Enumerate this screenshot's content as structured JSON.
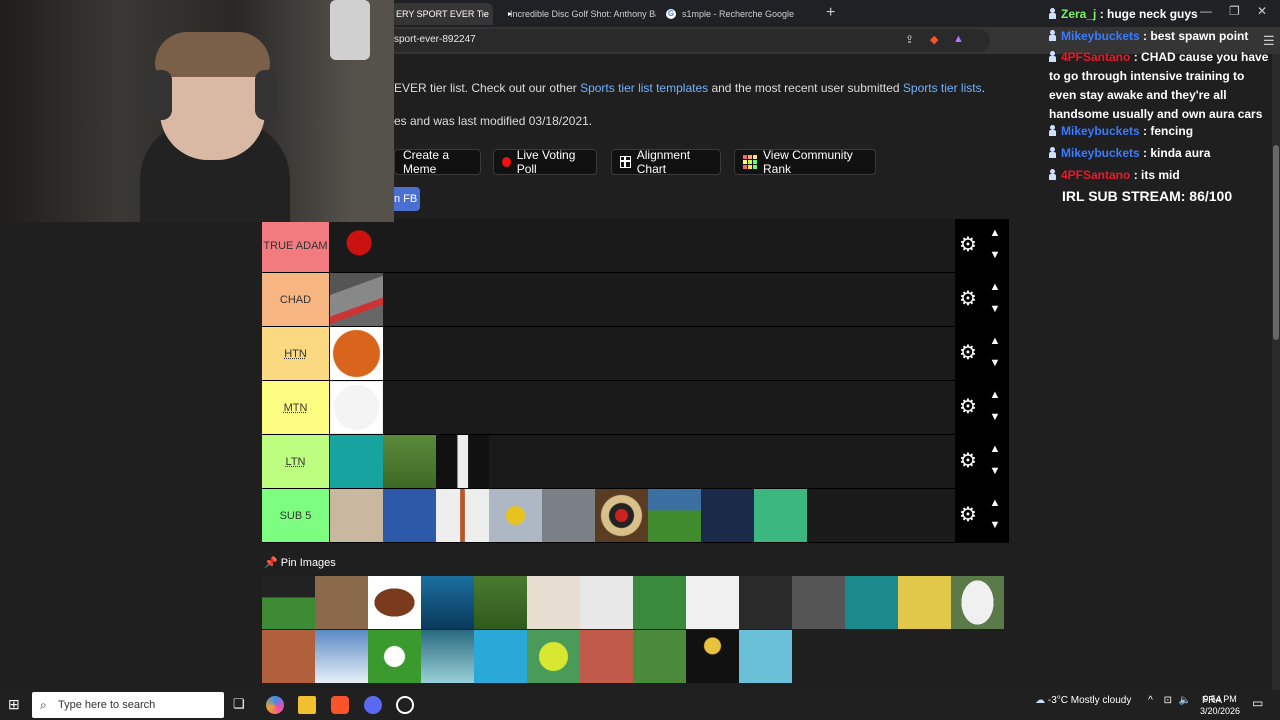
{
  "browser": {
    "tabs": [
      {
        "label": "ERY SPORT EVER Tie",
        "active": true
      },
      {
        "label": "Incredible Disc Golf Shot: Anthony Ba",
        "icon": "youtube-icon"
      },
      {
        "label": "s1mple - Recherche Google",
        "icon": "google-icon"
      }
    ],
    "new_tab": "+",
    "url": "sport-ever-892247"
  },
  "page": {
    "intro_prefix": "EVER tier list. Check out our other ",
    "intro_link1": "Sports tier list templates",
    "intro_mid": " and the most recent user submitted ",
    "intro_link2": "Sports tier lists",
    "intro_suffix": ".",
    "modified": "es and was last modified 03/18/2021.",
    "buttons": {
      "meme": "Create a Meme",
      "poll": "Live Voting Poll",
      "alignment": "Alignment Chart",
      "community": "View Community Rank",
      "fb": "n FB"
    },
    "tiers": [
      {
        "label": "TRUE ADAM",
        "color": "#f27b80",
        "items": 1
      },
      {
        "label": "CHAD",
        "color": "#f7b681",
        "items": 1
      },
      {
        "label": "HTN",
        "color": "#fbd981",
        "items": 1
      },
      {
        "label": "MTN",
        "color": "#fdfd81",
        "items": 1
      },
      {
        "label": "LTN",
        "color": "#bdfe80",
        "items": 3
      },
      {
        "label": "SUB 5",
        "color": "#7dfe80",
        "items": 9
      }
    ],
    "pin_label": "Pin Images"
  },
  "chat": {
    "messages": [
      {
        "user": "Zera_j",
        "user_color": "#7cf05a",
        "text": " : huge neck guys"
      },
      {
        "user": "Mikeybuckets",
        "user_color": "#3a7bff",
        "text": " : best spawn point"
      },
      {
        "user": "4PFSantano",
        "user_color": "#e81a2a",
        "text": " : CHAD cause you have to go through intensive training to even stay awake and they're all handsome usually and own aura cars"
      },
      {
        "user": "Mikeybuckets",
        "user_color": "#3a7bff",
        "text": " : fencing"
      },
      {
        "user": "Mikeybuckets",
        "user_color": "#3a7bff",
        "text": " : kinda aura"
      },
      {
        "user": "4PFSantano",
        "user_color": "#e81a2a",
        "text": " : its mid"
      }
    ],
    "sub_stream": "IRL SUB STREAM: 86/100"
  },
  "taskbar": {
    "search_placeholder": "Type here to search",
    "weather": "-3°C  Mostly cloudy",
    "lang": "FRA",
    "time": "9:54 PM",
    "date": "3/20/2026"
  }
}
